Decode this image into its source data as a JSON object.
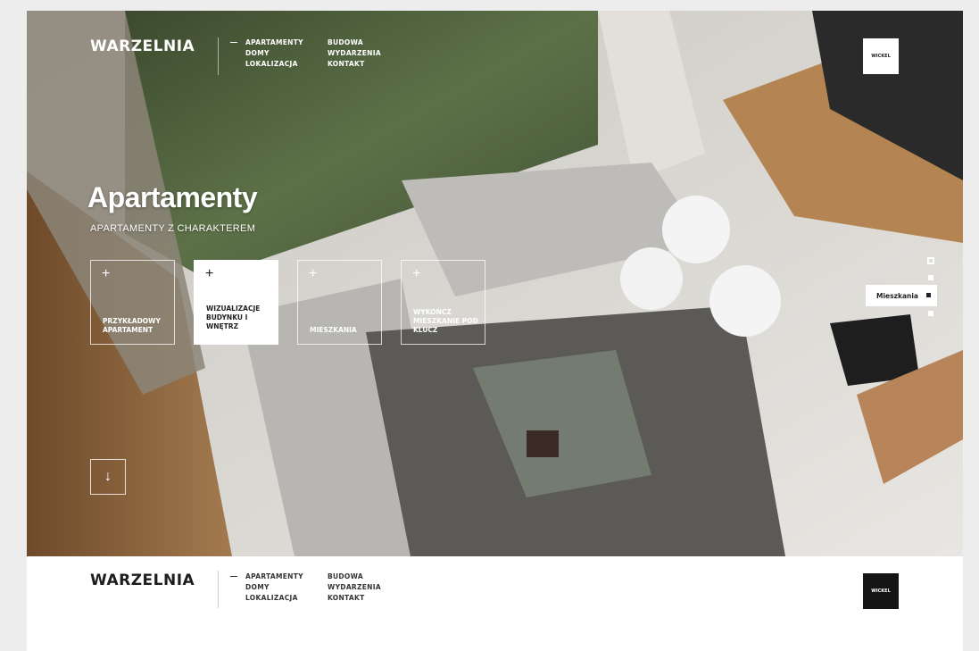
{
  "brand": {
    "logo": "WARZELNIA",
    "partner_badge": "WICKEL"
  },
  "nav": {
    "col1": [
      "APARTAMENTY",
      "DOMY",
      "LOKALIZACJA"
    ],
    "col2": [
      "BUDOWA",
      "WYDARZENIA",
      "KONTAKT"
    ]
  },
  "hero": {
    "title": "Apartamenty",
    "subtitle": "APARTAMENTY Z CHARAKTEREM",
    "tiles": [
      {
        "label": "PRZYKŁADOWY APARTAMENT",
        "active": false
      },
      {
        "label": "WIZUALIZACJE BUDYNKU I WNĘTRZ",
        "active": true
      },
      {
        "label": "MIESZKANIA",
        "active": false
      },
      {
        "label": "WYKOŃCZ MIESZKANIE POD KLUCZ",
        "active": false
      }
    ],
    "scroll_icon": "arrow-down-icon"
  },
  "section_nav": {
    "tooltip": "Mieszkania"
  },
  "colors": {
    "footer_bg": "#ffffff",
    "text_dark": "#1d1d1d"
  }
}
